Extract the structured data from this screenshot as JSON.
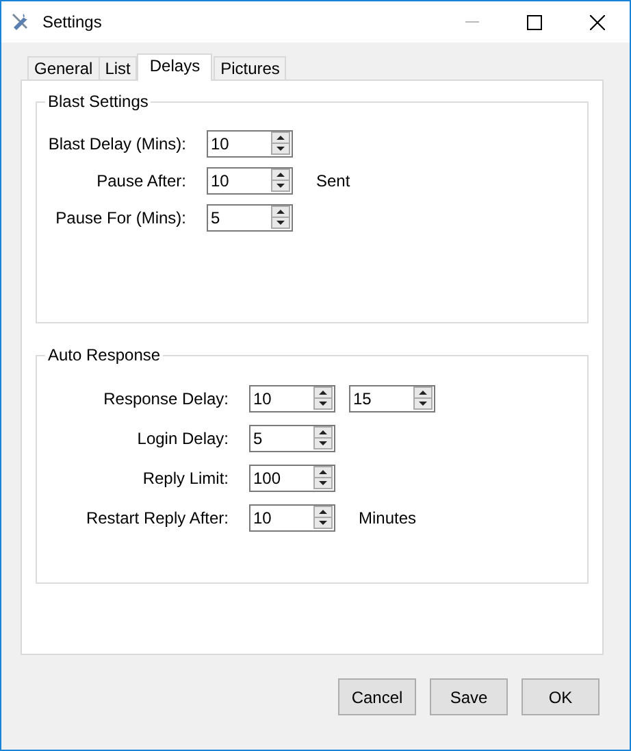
{
  "window": {
    "title": "Settings"
  },
  "tabs": [
    {
      "label": "General",
      "selected": false
    },
    {
      "label": "List",
      "selected": false
    },
    {
      "label": "Delays",
      "selected": true
    },
    {
      "label": "Pictures",
      "selected": false
    }
  ],
  "groups": [
    {
      "title": "Blast Settings",
      "rows": [
        {
          "label": "Blast Delay (Mins):",
          "spinners": [
            "10"
          ]
        },
        {
          "label": "Pause After:",
          "spinners": [
            "10"
          ],
          "suffix": "Sent"
        },
        {
          "label": "Pause For (Mins):",
          "spinners": [
            "5"
          ]
        }
      ]
    },
    {
      "title": "Auto Response",
      "rows": [
        {
          "label": "Response Delay:",
          "spinners": [
            "10",
            "15"
          ]
        },
        {
          "label": "Login Delay:",
          "spinners": [
            "5"
          ]
        },
        {
          "label": "Reply Limit:",
          "spinners": [
            "100"
          ]
        },
        {
          "label": "Restart Reply After:",
          "spinners": [
            "10"
          ],
          "suffix": "Minutes"
        }
      ]
    }
  ],
  "buttons": [
    "Cancel",
    "Save",
    "OK"
  ]
}
